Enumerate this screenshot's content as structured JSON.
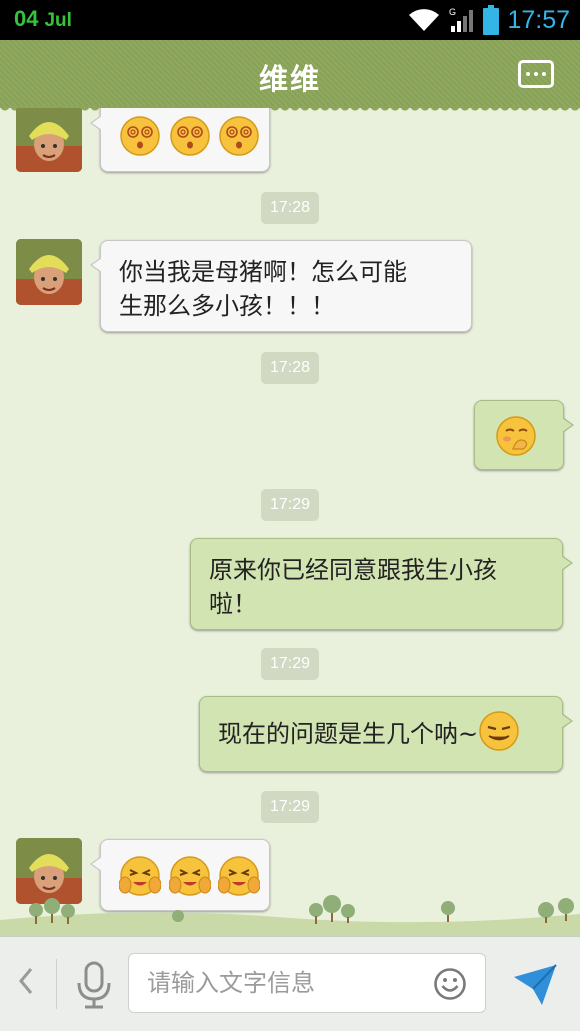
{
  "status_bar": {
    "day": "04",
    "month": "Jul",
    "time": "17:57",
    "time_color": "#33b5e5",
    "date_color": "#36c23a"
  },
  "header": {
    "title": "维维",
    "menu_icon": "more-icon",
    "bar_color": "#8ca65a"
  },
  "messages": [
    {
      "type": "in",
      "emojis": [
        "dizzy-face",
        "dizzy-face",
        "dizzy-face"
      ]
    },
    {
      "type": "time",
      "text": "17:28"
    },
    {
      "type": "in",
      "lines": [
        "你当我是母猪啊！怎么可能",
        "生那么多小孩！！！"
      ]
    },
    {
      "type": "time",
      "text": "17:28"
    },
    {
      "type": "out",
      "emojis": [
        "shy-face"
      ]
    },
    {
      "type": "time",
      "text": "17:29"
    },
    {
      "type": "out",
      "lines": [
        "原来你已经同意跟我生小孩",
        "啦！"
      ]
    },
    {
      "type": "time",
      "text": "17:29"
    },
    {
      "type": "out",
      "text": "现在的问题是生几个呐~",
      "emoji": "smirk-face"
    },
    {
      "type": "time",
      "text": "17:29"
    },
    {
      "type": "in",
      "emojis": [
        "cover-face",
        "cover-face",
        "cover-face"
      ]
    }
  ],
  "input_bar": {
    "placeholder": "请输入文字信息",
    "back_icon": "chevron-left-icon",
    "voice_icon": "microphone-icon",
    "emoji_icon": "smiley-icon",
    "send_icon": "send-icon"
  },
  "colors": {
    "chat_background": "#e9f0dc",
    "outgoing_bubble": "#d2e4b2",
    "incoming_bubble": "#f7f7f7",
    "send_button": "#2f8fd8"
  }
}
